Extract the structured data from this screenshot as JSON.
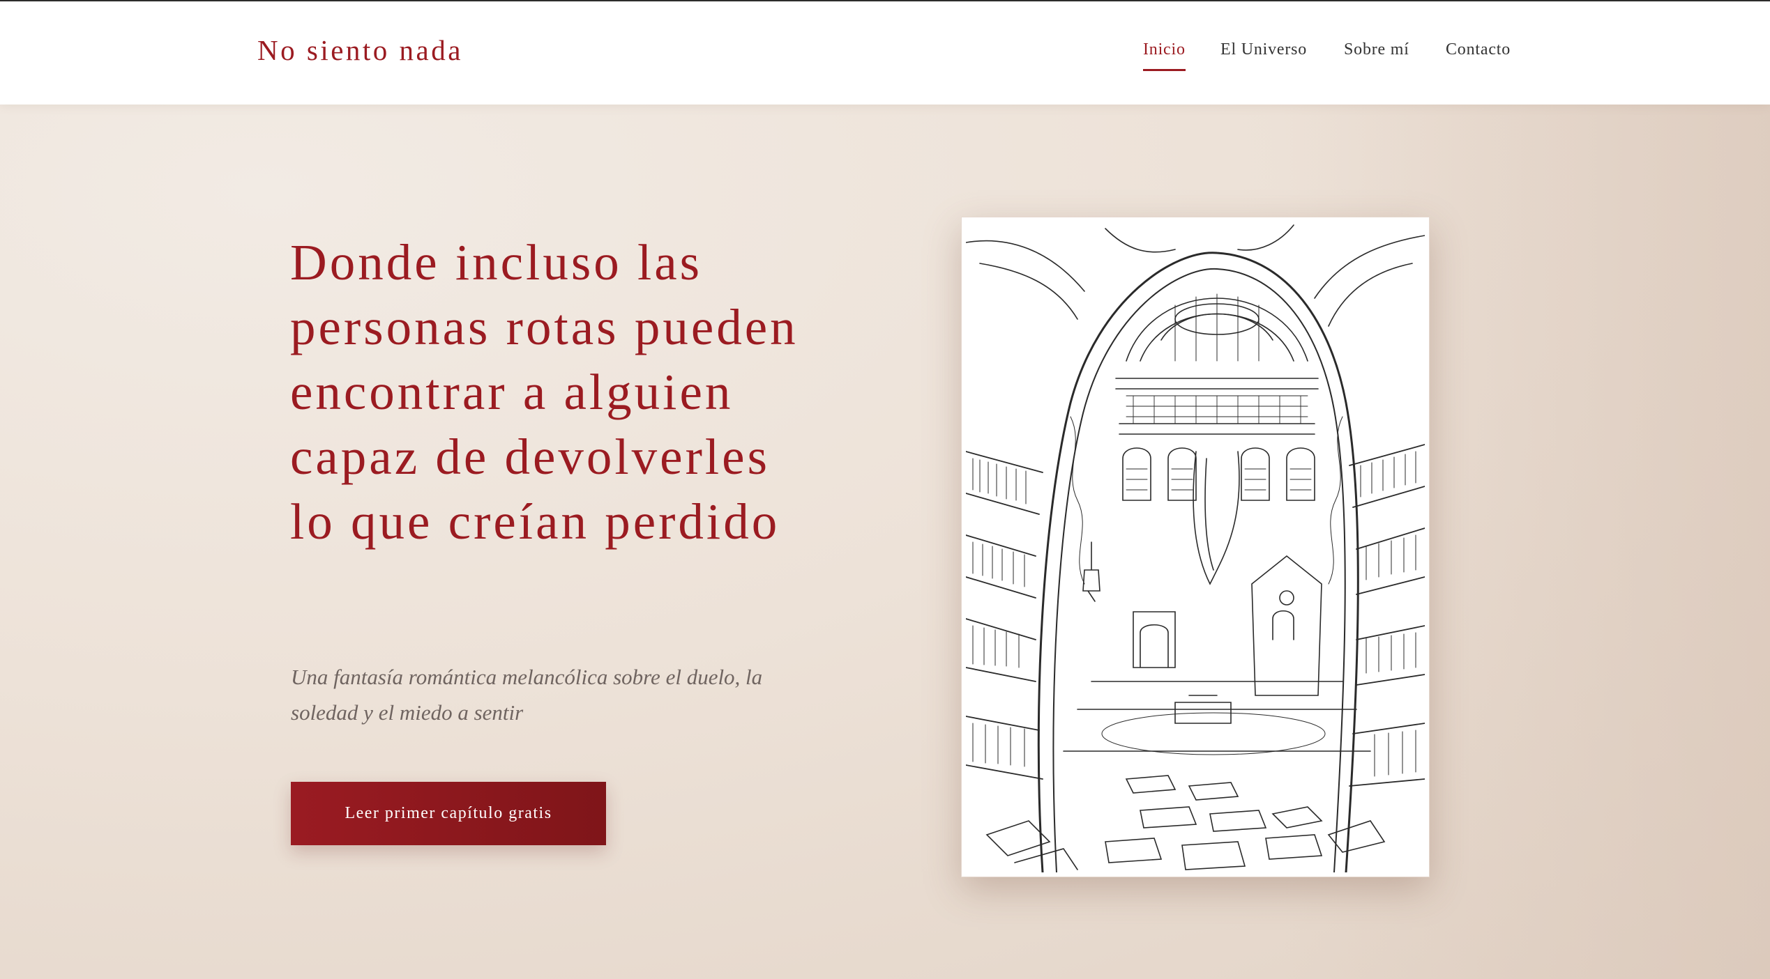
{
  "header": {
    "brand": "No siento nada",
    "nav": [
      {
        "label": "Inicio",
        "active": true
      },
      {
        "label": "El Universo",
        "active": false
      },
      {
        "label": "Sobre mí",
        "active": false
      },
      {
        "label": "Contacto",
        "active": false
      }
    ]
  },
  "hero": {
    "headline": "Donde incluso las personas rotas pueden encontrar a alguien capaz de devolverles lo que creían perdido",
    "subtitle": "Una fantasía romántica melancólica sobre el duelo, la soledad y el miedo a sentir",
    "cta_label": "Leer primer capítulo gratis",
    "illustration": "library-line-art-illustration"
  },
  "colors": {
    "accent": "#9b1b21",
    "background": "#efe6dd",
    "text_muted": "#6f6460"
  }
}
